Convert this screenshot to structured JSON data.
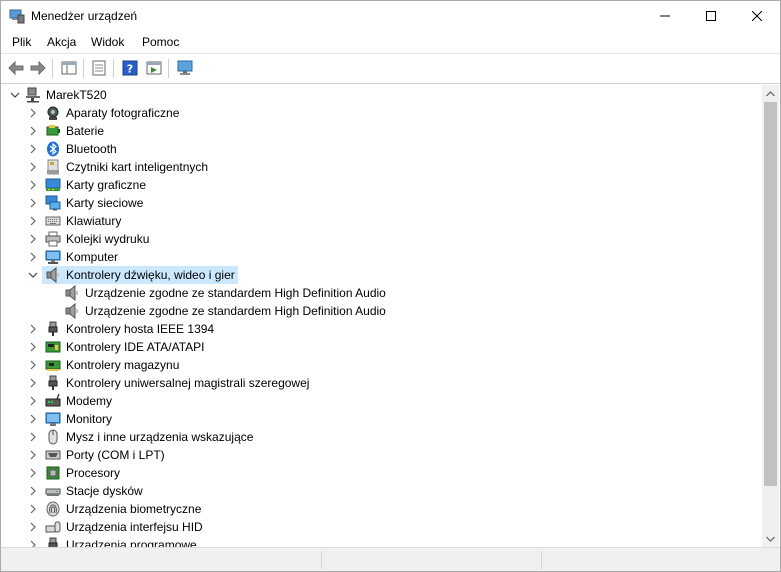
{
  "window": {
    "title": "Menedżer urządzeń"
  },
  "menu": [
    {
      "label": "Plik"
    },
    {
      "label": "Akcja"
    },
    {
      "label": "Widok"
    },
    {
      "label": "Pomoc"
    }
  ],
  "toolbar": {
    "buttons": [
      "back-arrow-icon",
      "forward-arrow-icon",
      "show-hide-console-tree-icon",
      "properties-icon",
      "help-icon",
      "action-pane-icon",
      "scan-hardware-icon"
    ]
  },
  "tree": {
    "root": {
      "label": "MarekT520",
      "icon": "computer-network-icon"
    },
    "items": [
      {
        "label": "Aparaty fotograficzne",
        "icon": "camera-icon",
        "expanded": false
      },
      {
        "label": "Baterie",
        "icon": "battery-icon",
        "expanded": false
      },
      {
        "label": "Bluetooth",
        "icon": "bluetooth-icon",
        "expanded": false
      },
      {
        "label": "Czytniki kart inteligentnych",
        "icon": "smartcard-reader-icon",
        "expanded": false
      },
      {
        "label": "Karty graficzne",
        "icon": "display-adapter-icon",
        "expanded": false
      },
      {
        "label": "Karty sieciowe",
        "icon": "network-adapter-icon",
        "expanded": false
      },
      {
        "label": "Klawiatury",
        "icon": "keyboard-icon",
        "expanded": false
      },
      {
        "label": "Kolejki wydruku",
        "icon": "printer-icon",
        "expanded": false
      },
      {
        "label": "Komputer",
        "icon": "computer-icon",
        "expanded": false
      },
      {
        "label": "Kontrolery dźwięku, wideo i gier",
        "icon": "speaker-icon",
        "expanded": true,
        "selected": true,
        "children": [
          {
            "label": "Urządzenie zgodne ze standardem High Definition Audio",
            "icon": "speaker-icon"
          },
          {
            "label": "Urządzenie zgodne ze standardem High Definition Audio",
            "icon": "speaker-icon"
          }
        ]
      },
      {
        "label": "Kontrolery hosta IEEE 1394",
        "icon": "usb-connector-icon",
        "expanded": false
      },
      {
        "label": "Kontrolery IDE ATA/ATAPI",
        "icon": "ide-controller-icon",
        "expanded": false
      },
      {
        "label": "Kontrolery magazynu",
        "icon": "storage-controller-icon",
        "expanded": false
      },
      {
        "label": "Kontrolery uniwersalnej magistrali szeregowej",
        "icon": "usb-connector-icon",
        "expanded": false
      },
      {
        "label": "Modemy",
        "icon": "modem-icon",
        "expanded": false
      },
      {
        "label": "Monitory",
        "icon": "monitor-icon",
        "expanded": false
      },
      {
        "label": "Mysz i inne urządzenia wskazujące",
        "icon": "mouse-icon",
        "expanded": false
      },
      {
        "label": "Porty (COM i LPT)",
        "icon": "port-icon",
        "expanded": false
      },
      {
        "label": "Procesory",
        "icon": "processor-icon",
        "expanded": false
      },
      {
        "label": "Stacje dysków",
        "icon": "disk-drive-icon",
        "expanded": false
      },
      {
        "label": "Urządzenia biometryczne",
        "icon": "fingerprint-icon",
        "expanded": false
      },
      {
        "label": "Urządzenia interfejsu HID",
        "icon": "hid-icon",
        "expanded": false
      },
      {
        "label": "Urządzenia programowe",
        "icon": "software-device-icon",
        "expanded": false
      }
    ]
  },
  "colors": {
    "selection": "#cce8ff",
    "scrollbar_track": "#f0f0f0",
    "scrollbar_thumb": "#c1c1c1"
  }
}
